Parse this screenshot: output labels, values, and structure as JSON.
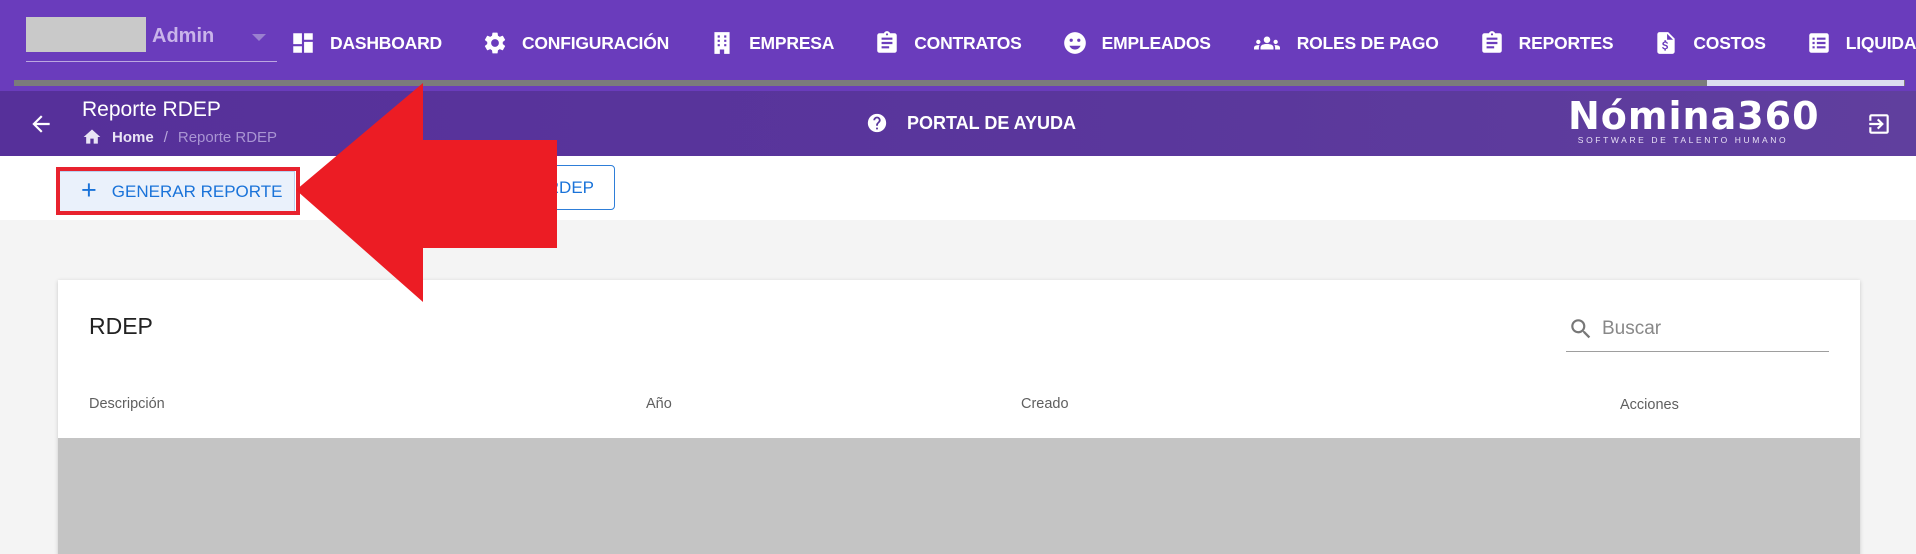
{
  "user": {
    "name": "Admin"
  },
  "nav": {
    "items": [
      {
        "label": "DASHBOARD",
        "icon": "dashboard-icon"
      },
      {
        "label": "CONFIGURACIÓN",
        "icon": "gear-icon"
      },
      {
        "label": "EMPRESA",
        "icon": "building-icon"
      },
      {
        "label": "CONTRATOS",
        "icon": "clipboard-icon"
      },
      {
        "label": "EMPLEADOS",
        "icon": "face-icon"
      },
      {
        "label": "ROLES DE PAGO",
        "icon": "group-icon"
      },
      {
        "label": "REPORTES",
        "icon": "clipboard-icon"
      },
      {
        "label": "COSTOS",
        "icon": "invoice-dollar-icon"
      },
      {
        "label": "LIQUIDACIONES",
        "icon": "list-icon"
      }
    ]
  },
  "header": {
    "title": "Reporte RDEP",
    "breadcrumb": {
      "home": "Home",
      "separator": "/",
      "current": "Reporte RDEP"
    },
    "help_label": "PORTAL DE AYUDA",
    "brand_name": "Nómina360",
    "brand_tagline": "SOFTWARE DE TALENTO HUMANO"
  },
  "toolbar": {
    "generate_label": "GENERAR REPORTE",
    "second_label_visible": "RDEP"
  },
  "card": {
    "title": "RDEP",
    "search_placeholder": "Buscar",
    "columns": [
      "Descripción",
      "Año",
      "Creado",
      "Acciones"
    ]
  },
  "colors": {
    "topbar": "#6a3cbc",
    "subbar": "#56309a",
    "accent_blue": "#1a73d9",
    "highlight_red": "#e8222e",
    "arrow_red": "#ec1c24"
  }
}
